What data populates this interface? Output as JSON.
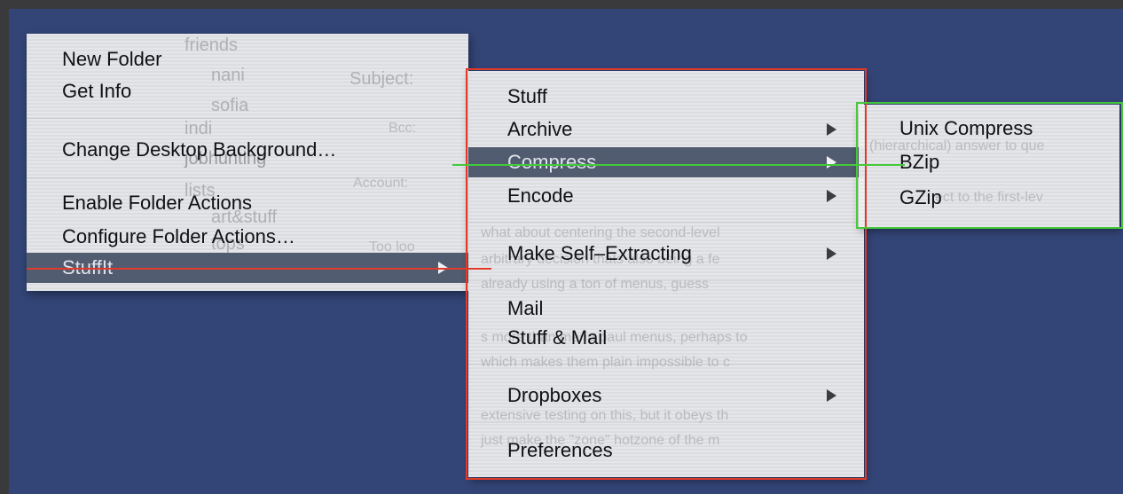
{
  "menu1": {
    "items": [
      {
        "label": "New Folder"
      },
      {
        "label": "Get Info"
      },
      {
        "label": "Change Desktop Background…"
      },
      {
        "label": "Enable Folder Actions"
      },
      {
        "label": "Configure Folder Actions…"
      },
      {
        "label": "StuffIt",
        "submenu": true,
        "highlighted": true
      }
    ]
  },
  "menu2": {
    "items": [
      {
        "label": "Stuff"
      },
      {
        "label": "Archive",
        "submenu": true
      },
      {
        "label": "Compress",
        "submenu": true,
        "highlighted": true
      },
      {
        "label": "Encode",
        "submenu": true
      },
      {
        "label": "Make Self–Extracting",
        "submenu": true
      },
      {
        "label": "Mail"
      },
      {
        "label": "Stuff & Mail"
      },
      {
        "label": "Dropboxes",
        "submenu": true
      },
      {
        "label": "Preferences"
      }
    ]
  },
  "menu3": {
    "items": [
      {
        "label": "Unix Compress"
      },
      {
        "label": "BZip"
      },
      {
        "label": "GZip"
      }
    ]
  },
  "background_ghost": {
    "mail_list": [
      "friends",
      "nani",
      "sofia",
      "indi",
      "jobhunting",
      "lists",
      "art&stuff",
      "tops"
    ],
    "mail_fields": [
      "Subject:",
      "Bcc:",
      "Account:",
      "Too loo"
    ],
    "body_lines": [
      "(hierarchical) answer to que",
      "ect to the first-lev",
      "what about centering the second-level",
      "arbitrary decision thats also being a fe",
      "already using a ton of menus, guess",
      "s more than menu paul menus, perhaps to",
      "which makes them plain impossible to c",
      "extensive testing on this, but it obeys th",
      "just make the \"zone\" hotzone of the m"
    ]
  },
  "colors": {
    "desktop": "#334577",
    "highlight": "#555e70",
    "red_guide": "#e23a2a",
    "green_guide": "#45c93a"
  },
  "icons": {
    "submenu_indicator": "triangle-right-icon"
  }
}
